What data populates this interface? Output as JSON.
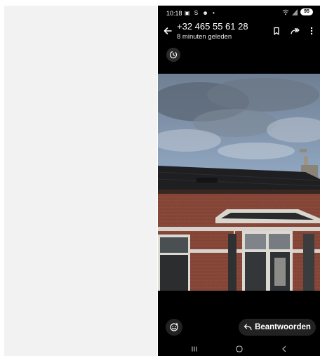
{
  "status_bar": {
    "time": "10:18",
    "notification_icons": "▣ S ☻ •",
    "battery": "95"
  },
  "header": {
    "title": "+32 465 55 61 28",
    "subtitle": "8 minuten geleden"
  },
  "actions": {
    "reply_label": "Beantwoorden"
  },
  "icons": {
    "back": "arrow-left-icon",
    "bookmark": "bookmark-icon",
    "forward": "forward-icon",
    "more": "more-vertical-icon",
    "timer": "timer-icon",
    "emoji": "emoji-icon",
    "reply": "reply-icon"
  },
  "colors": {
    "app_background": "#000000",
    "button_background": "#222222",
    "text": "#ffffff"
  }
}
